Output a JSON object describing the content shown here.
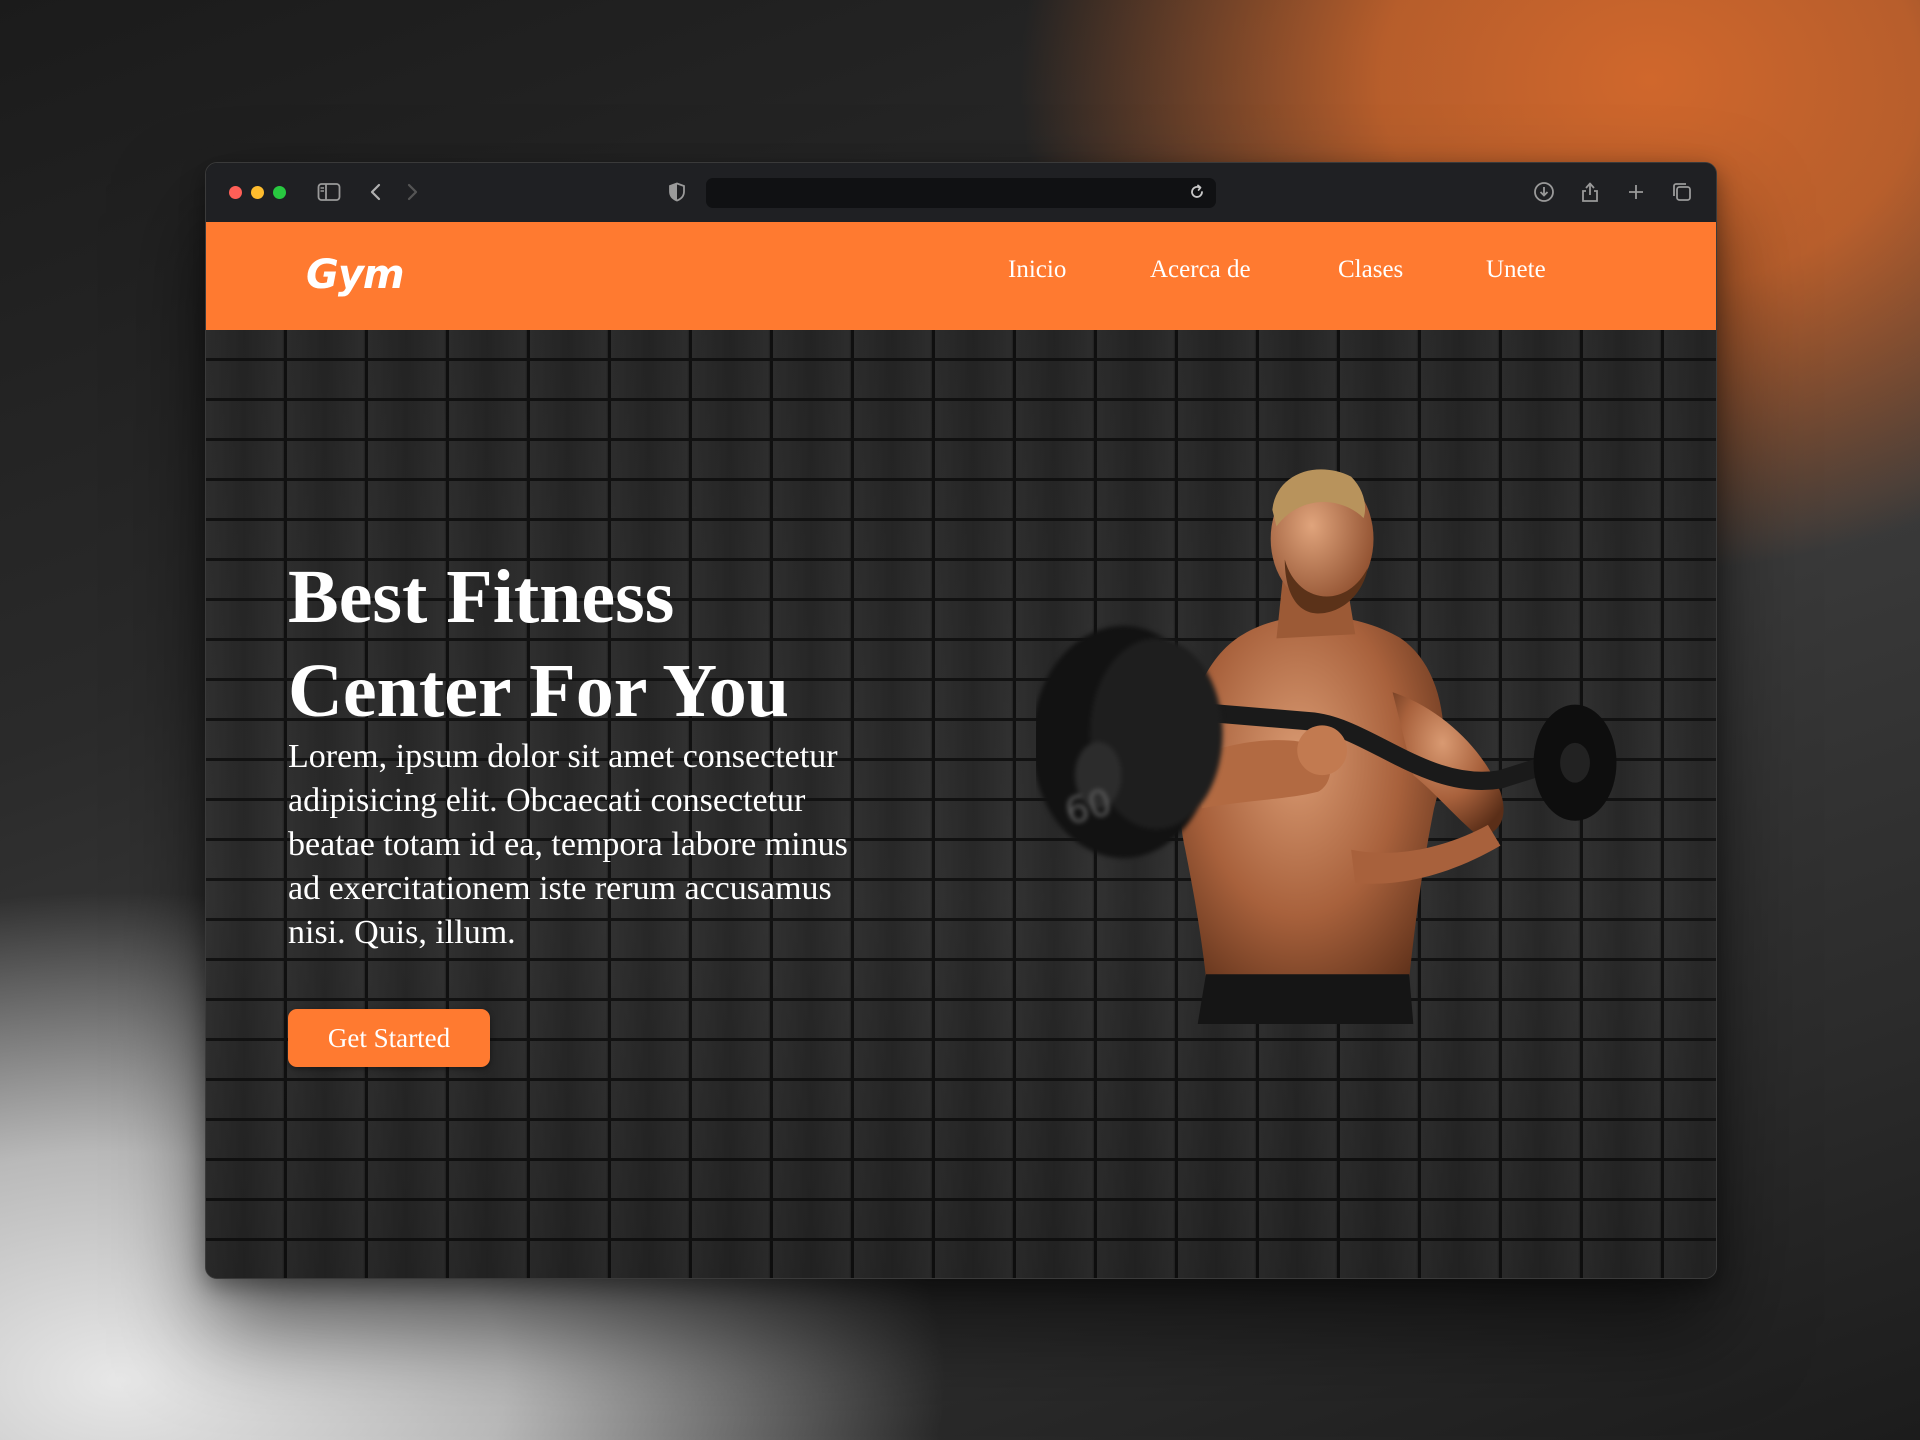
{
  "browser": {
    "address": ""
  },
  "site": {
    "logo": "Gym",
    "nav": [
      {
        "label": "Inicio"
      },
      {
        "label": "Acerca de"
      },
      {
        "label": "Clases"
      },
      {
        "label": "Unete"
      }
    ]
  },
  "hero": {
    "title_line1": "Best Fitness",
    "title_line2": "Center For You",
    "text": "Lorem, ipsum dolor sit amet consectetur adipisicing elit. Obcaecati consectetur beatae totam id ea, tempora labore minus ad exercitationem iste rerum accusamus nisi. Quis, illum.",
    "cta_label": "Get Started"
  },
  "colors": {
    "accent": "#ff7a30",
    "hero_bg": "#2a2a2a",
    "titlebar": "#1f2023"
  }
}
